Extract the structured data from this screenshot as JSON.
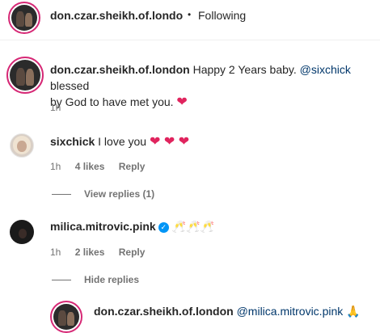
{
  "header": {
    "username": "don.czar.sheikh.of.londo",
    "separator": "•",
    "follow_status": "Following"
  },
  "caption": {
    "username": "don.czar.sheikh.of.london",
    "text_before": "Happy 2 Years baby. ",
    "mention": "@sixchick",
    "text_after": " blessed",
    "text_line2": "by God to have met you. ",
    "emoji": "❤",
    "time": "1h"
  },
  "comments": [
    {
      "username": "sixchick",
      "text": "I love you ",
      "emoji": "❤ ❤ ❤",
      "time": "1h",
      "likes": "4 likes",
      "reply": "Reply",
      "view_replies": "View replies (1)"
    },
    {
      "username": "milica.mitrovic.pink",
      "emoji": "🥂🥂🥂",
      "time": "1h",
      "likes": "2 likes",
      "reply": "Reply",
      "hide_replies": "Hide replies"
    }
  ],
  "nested_reply": {
    "username": "don.czar.sheikh.of.london",
    "mention": "@milica.mitrovic.pink",
    "emoji": "🙏"
  },
  "colors": {
    "mention": "#00376b",
    "heart": "#e0245e",
    "verified": "#0095f6",
    "muted": "#737373"
  }
}
